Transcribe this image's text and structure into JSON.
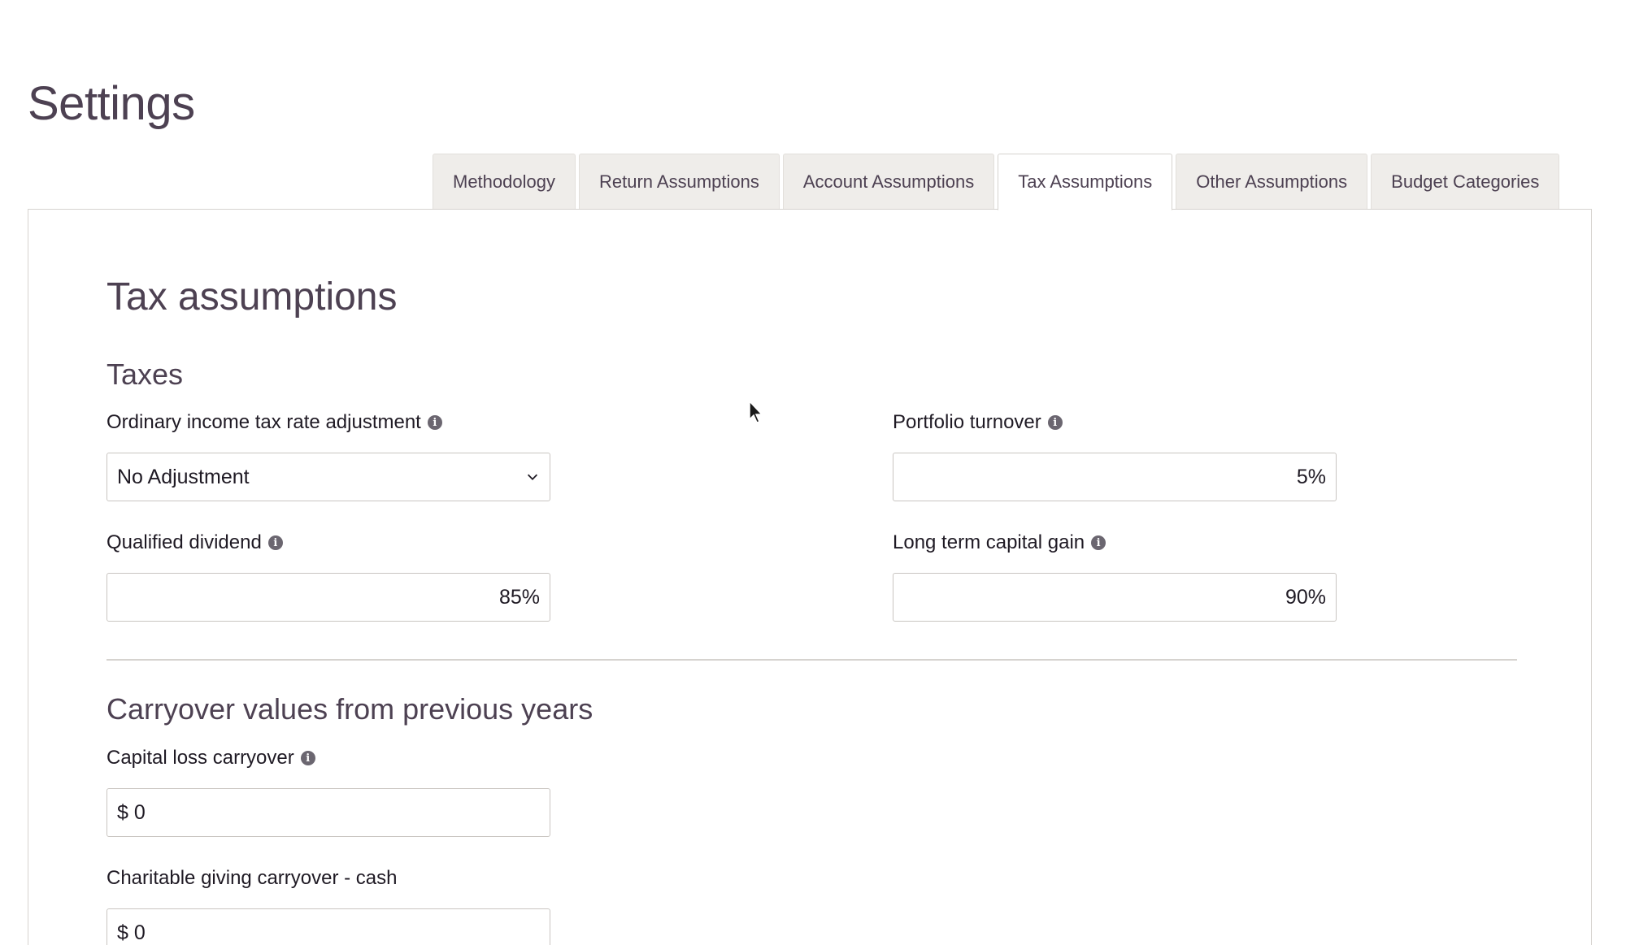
{
  "page": {
    "title": "Settings"
  },
  "tabs": [
    {
      "label": "Methodology",
      "active": false
    },
    {
      "label": "Return Assumptions",
      "active": false
    },
    {
      "label": "Account Assumptions",
      "active": false
    },
    {
      "label": "Tax Assumptions",
      "active": true
    },
    {
      "label": "Other Assumptions",
      "active": false
    },
    {
      "label": "Budget Categories",
      "active": false
    }
  ],
  "main": {
    "title": "Tax assumptions",
    "taxes": {
      "title": "Taxes",
      "ordinary_income": {
        "label": "Ordinary income tax rate adjustment",
        "value": "No Adjustment",
        "icon": "info-icon"
      },
      "portfolio_turnover": {
        "label": "Portfolio turnover",
        "value": "5%",
        "icon": "info-icon"
      },
      "qualified_dividend": {
        "label": "Qualified dividend",
        "value": "85%",
        "icon": "info-icon"
      },
      "long_term_capital_gain": {
        "label": "Long term capital gain",
        "value": "90%",
        "icon": "info-icon"
      }
    },
    "carryover": {
      "title": "Carryover values from previous years",
      "capital_loss": {
        "label": "Capital loss carryover",
        "value": "$ 0",
        "icon": "info-icon"
      },
      "charitable_cash": {
        "label": "Charitable giving carryover - cash",
        "value": "$ 0"
      }
    }
  },
  "colors": {
    "heading": "#4d4152",
    "tab_bg": "#efedea",
    "border": "#d6d3cf",
    "info_icon": "#6b6670"
  }
}
